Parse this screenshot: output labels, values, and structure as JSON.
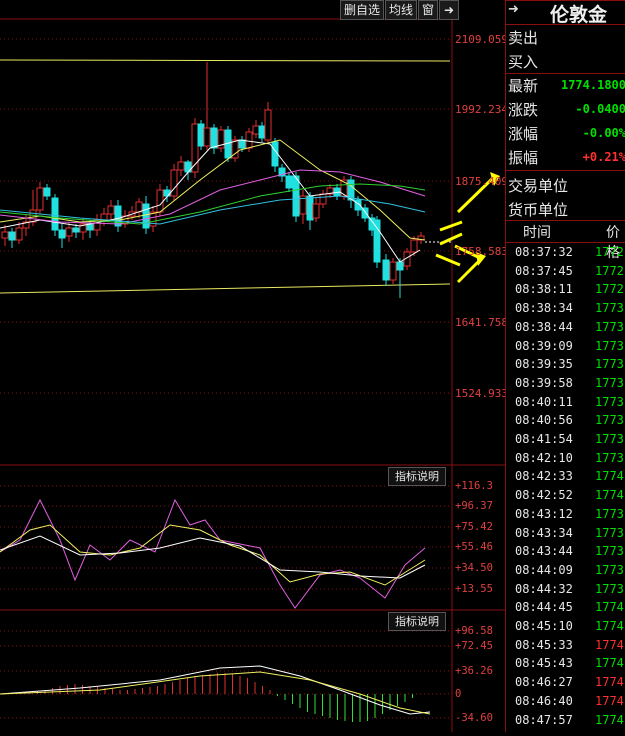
{
  "toolbar": {
    "buttons": [
      {
        "label": "删自选"
      },
      {
        "label": "均线"
      },
      {
        "label": "窗"
      }
    ]
  },
  "price_axis": [
    "2109.059",
    "1992.234",
    "1875.409",
    "1758.583",
    "1641.758",
    "1524.933"
  ],
  "indicator1": {
    "button": "指标说明",
    "axis": [
      "+116.3",
      "+96.37",
      "+75.42",
      "+55.46",
      "+34.50",
      "+13.55"
    ]
  },
  "indicator2": {
    "button": "指标说明",
    "axis": [
      "+96.58",
      "+72.45",
      "+36.26",
      "0",
      "-34.60"
    ]
  },
  "side": {
    "title": "伦敦金",
    "rows": [
      {
        "label": "卖出",
        "value": "",
        "color": "#00e000"
      },
      {
        "label": "买入",
        "value": "",
        "color": "#00e000"
      },
      {
        "label": "最新",
        "value": "1774.1800",
        "color": "#00e000"
      },
      {
        "label": "涨跌",
        "value": "-0.0400",
        "color": "#00e000"
      },
      {
        "label": "涨幅",
        "value": "-0.00%",
        "color": "#00e000"
      },
      {
        "label": "振幅",
        "value": "+0.21%",
        "color": "#ff3030"
      },
      {
        "label": "交易单位",
        "value": "",
        "color": "#e8e8e8"
      },
      {
        "label": "货币单位",
        "value": "",
        "color": "#e8e8e8"
      }
    ],
    "tick_headers": {
      "time": "时间",
      "price": "价格"
    },
    "ticks": [
      {
        "time": "08:37:32",
        "price": "1772.",
        "dir": "green"
      },
      {
        "time": "08:37:45",
        "price": "1772.",
        "dir": "green"
      },
      {
        "time": "08:38:11",
        "price": "1772.",
        "dir": "green"
      },
      {
        "time": "08:38:34",
        "price": "1773.",
        "dir": "green"
      },
      {
        "time": "08:38:44",
        "price": "1773.",
        "dir": "green"
      },
      {
        "time": "08:39:09",
        "price": "1773.",
        "dir": "green"
      },
      {
        "time": "08:39:35",
        "price": "1773.",
        "dir": "green"
      },
      {
        "time": "08:39:58",
        "price": "1773.",
        "dir": "green"
      },
      {
        "time": "08:40:11",
        "price": "1773.",
        "dir": "green"
      },
      {
        "time": "08:40:56",
        "price": "1773.",
        "dir": "green"
      },
      {
        "time": "08:41:54",
        "price": "1773.",
        "dir": "green"
      },
      {
        "time": "08:42:10",
        "price": "1773.",
        "dir": "green"
      },
      {
        "time": "08:42:33",
        "price": "1774.",
        "dir": "green"
      },
      {
        "time": "08:42:52",
        "price": "1774.",
        "dir": "green"
      },
      {
        "time": "08:43:12",
        "price": "1773.",
        "dir": "green"
      },
      {
        "time": "08:43:34",
        "price": "1773.",
        "dir": "green"
      },
      {
        "time": "08:43:44",
        "price": "1773.",
        "dir": "green"
      },
      {
        "time": "08:44:09",
        "price": "1773.",
        "dir": "green"
      },
      {
        "time": "08:44:32",
        "price": "1773.",
        "dir": "green"
      },
      {
        "time": "08:44:45",
        "price": "1774.",
        "dir": "green"
      },
      {
        "time": "08:45:10",
        "price": "1774.",
        "dir": "green"
      },
      {
        "time": "08:45:33",
        "price": "1774.",
        "dir": "red"
      },
      {
        "time": "08:45:43",
        "price": "1774.",
        "dir": "green"
      },
      {
        "time": "08:46:27",
        "price": "1774.",
        "dir": "red"
      },
      {
        "time": "08:46:40",
        "price": "1774.",
        "dir": "red"
      },
      {
        "time": "08:47:57",
        "price": "1774.",
        "dir": "green"
      }
    ]
  },
  "colors": {
    "up": "#e03030",
    "down": "#20e0e0",
    "grid": "#8a1010",
    "support": "#e8e860"
  }
}
